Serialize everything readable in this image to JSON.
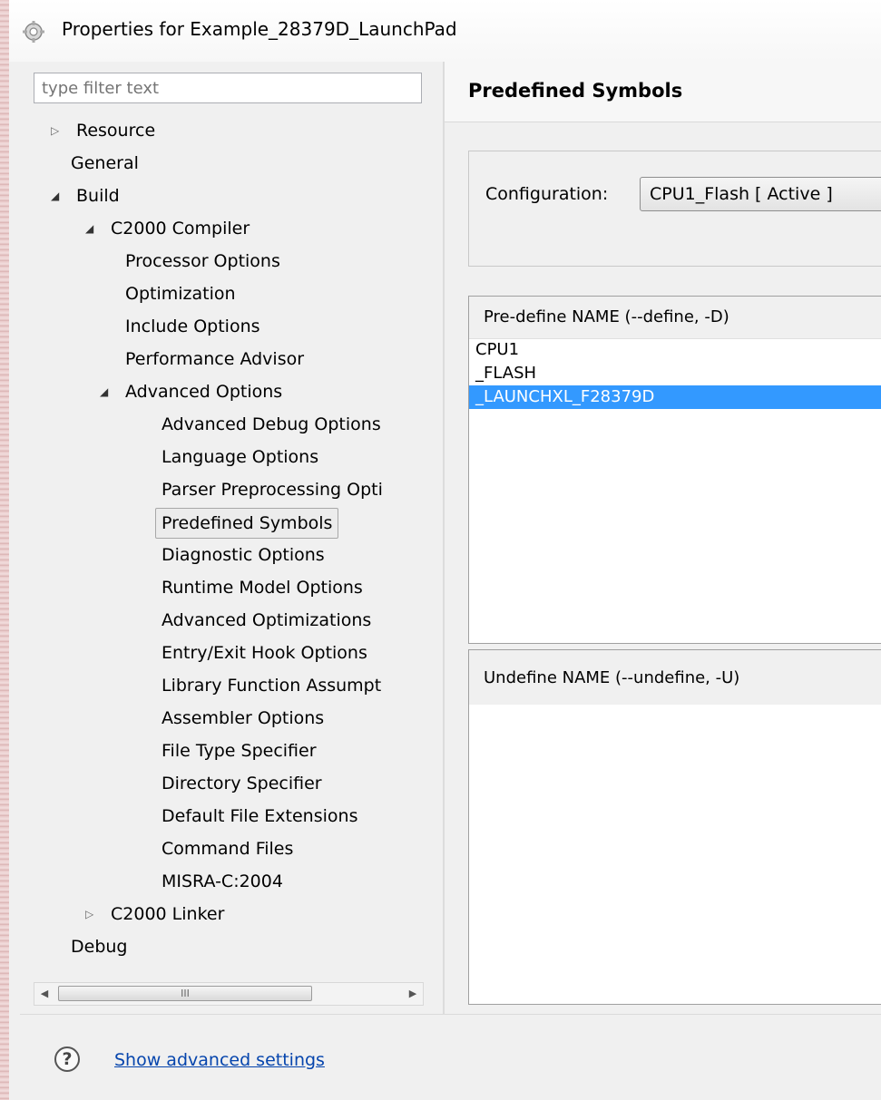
{
  "window": {
    "title": "Properties for Example_28379D_LaunchPad"
  },
  "filter": {
    "placeholder": "type filter text"
  },
  "tree": {
    "items": [
      {
        "label": "Resource",
        "arrow": "▷"
      },
      {
        "label": "General",
        "arrow": ""
      },
      {
        "label": "Build",
        "arrow": "◢"
      },
      {
        "label": "C2000 Compiler",
        "arrow": "◢"
      },
      {
        "label": "Processor Options",
        "arrow": ""
      },
      {
        "label": "Optimization",
        "arrow": ""
      },
      {
        "label": "Include Options",
        "arrow": ""
      },
      {
        "label": "Performance Advisor",
        "arrow": ""
      },
      {
        "label": "Advanced Options",
        "arrow": "◢"
      },
      {
        "label": "Advanced Debug Options",
        "arrow": ""
      },
      {
        "label": "Language Options",
        "arrow": ""
      },
      {
        "label": "Parser Preprocessing Opti",
        "arrow": ""
      },
      {
        "label": "Predefined Symbols",
        "arrow": ""
      },
      {
        "label": "Diagnostic Options",
        "arrow": ""
      },
      {
        "label": "Runtime Model Options",
        "arrow": ""
      },
      {
        "label": "Advanced Optimizations",
        "arrow": ""
      },
      {
        "label": "Entry/Exit Hook Options",
        "arrow": ""
      },
      {
        "label": "Library Function Assumpt",
        "arrow": ""
      },
      {
        "label": "Assembler Options",
        "arrow": ""
      },
      {
        "label": "File Type Specifier",
        "arrow": ""
      },
      {
        "label": "Directory Specifier",
        "arrow": ""
      },
      {
        "label": "Default File Extensions",
        "arrow": ""
      },
      {
        "label": "Command Files",
        "arrow": ""
      },
      {
        "label": "MISRA-C:2004",
        "arrow": ""
      },
      {
        "label": "C2000 Linker",
        "arrow": "▷"
      },
      {
        "label": "Debug",
        "arrow": ""
      }
    ],
    "selected": "Predefined Symbols"
  },
  "scrollbar": {
    "left": "◀",
    "right": "▶",
    "grip": "III"
  },
  "page": {
    "title": "Predefined Symbols",
    "config_label": "Configuration:",
    "config_value": "CPU1_Flash  [ Active ]",
    "define_header": "Pre-define NAME (--define, -D)",
    "defines": [
      "CPU1",
      "_FLASH",
      "_LAUNCHXL_F28379D"
    ],
    "selected_define": "_LAUNCHXL_F28379D",
    "undefine_header": "Undefine NAME (--undefine, -U)"
  },
  "footer": {
    "help": "?",
    "advanced_link": "Show advanced settings"
  },
  "colors": {
    "selection": "#3399ff",
    "link": "#0645ad"
  }
}
